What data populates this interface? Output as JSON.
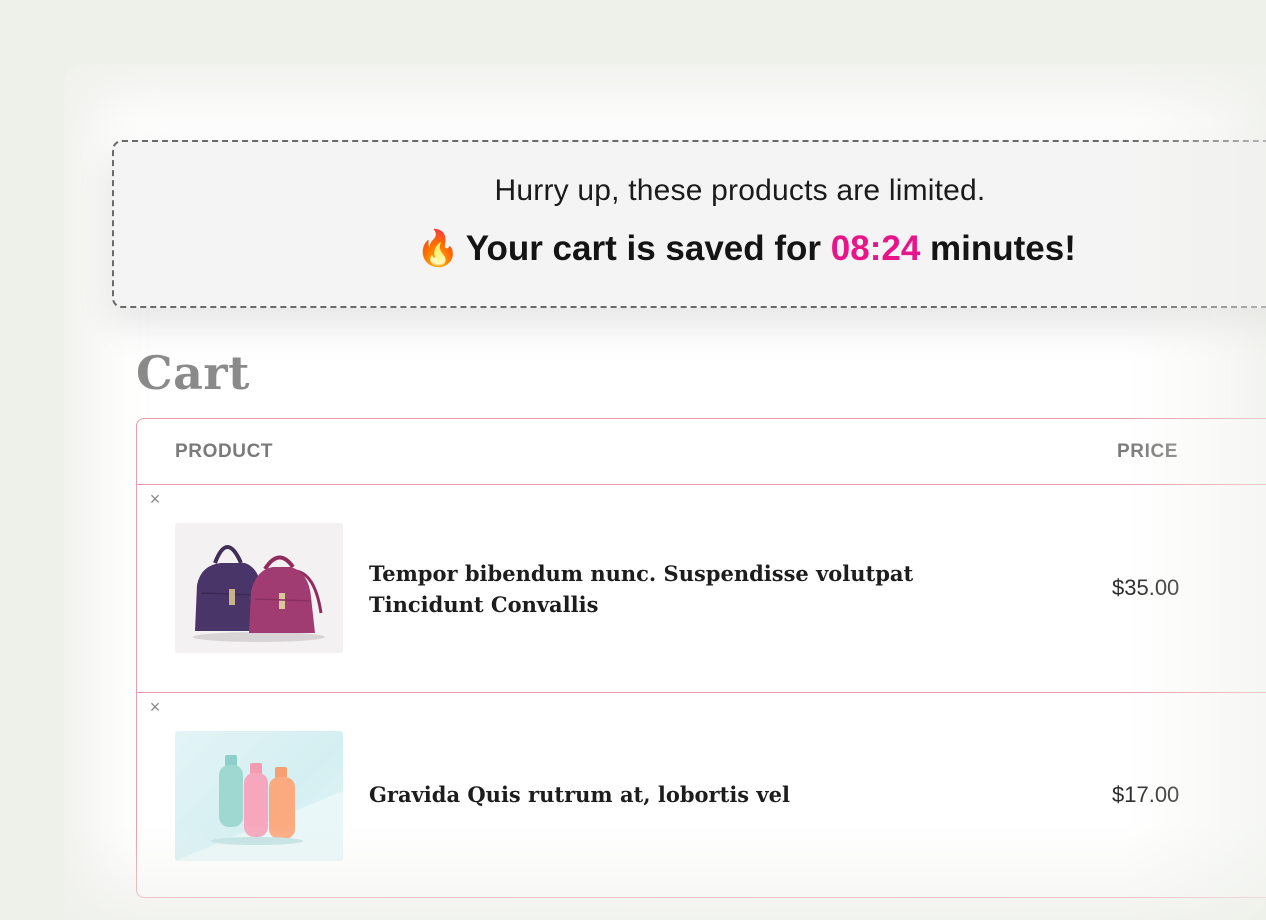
{
  "timer": {
    "line1": "Hurry up, these products are limited.",
    "line2_prefix": "Your cart is saved for",
    "time": "08:24",
    "line2_suffix": "minutes!",
    "flame_icon": "🔥",
    "accent_color": "#e8158a"
  },
  "cart": {
    "title": "Cart",
    "columns": [
      "PRODUCT",
      "PRICE"
    ],
    "items": [
      {
        "name_line1": "Tempor bibendum nunc. Suspendisse volutpat",
        "name_line2": "Tincidunt Convallis",
        "price": "$35.00",
        "thumbnail": "handbags-image"
      },
      {
        "name_line1": "Gravida Quis rutrum at, lobortis vel",
        "name_line2": "",
        "price": "$17.00",
        "thumbnail": "bottles-image"
      }
    ],
    "remove_icon": "×"
  }
}
